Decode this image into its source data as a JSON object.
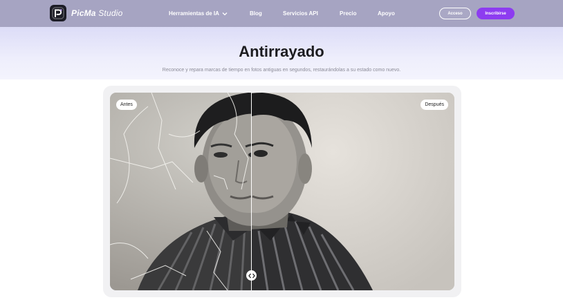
{
  "nav": {
    "brand_bold": "PicMa",
    "brand_light": " Studio",
    "menu": [
      {
        "label": "Herramientas de IA",
        "has_dropdown": true
      },
      {
        "label": "Blog",
        "has_dropdown": false
      },
      {
        "label": "Servicios API",
        "has_dropdown": false
      },
      {
        "label": "Precio",
        "has_dropdown": false
      },
      {
        "label": "Apoyo",
        "has_dropdown": false
      }
    ],
    "login_label": "Acceso",
    "signup_label": "Inscribirse"
  },
  "hero": {
    "title": "Antirrayado",
    "subtitle": "Reconoce y repara marcas de tiempo en fotos antiguas en segundos, restaurándolas a su estado como nuevo."
  },
  "compare": {
    "before_label": "Antes",
    "after_label": "Después",
    "split_position": 0.41
  },
  "colors": {
    "nav_bg": "#a6a4c2",
    "accent": "#8d3cf0",
    "hero_bg": "#dcdcf7"
  },
  "icons": {
    "logo": "picma-logo-icon",
    "dropdown": "chevron-down-icon",
    "handle": "drag-arrows-icon"
  }
}
